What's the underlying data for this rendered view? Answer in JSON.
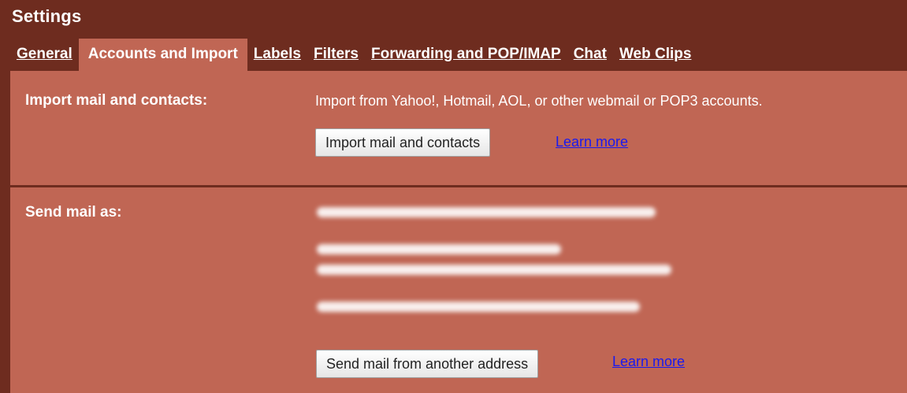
{
  "header": {
    "title": "Settings"
  },
  "tabs": [
    {
      "label": "General",
      "active": false
    },
    {
      "label": "Accounts and Import",
      "active": true
    },
    {
      "label": "Labels",
      "active": false
    },
    {
      "label": "Filters",
      "active": false
    },
    {
      "label": "Forwarding and POP/IMAP",
      "active": false
    },
    {
      "label": "Chat",
      "active": false
    },
    {
      "label": "Web Clips",
      "active": false
    }
  ],
  "import_section": {
    "label": "Import mail and contacts:",
    "description": "Import from Yahoo!, Hotmail, AOL, or other webmail or POP3 accounts.",
    "button_label": "Import mail and contacts",
    "learn_more": "Learn more"
  },
  "send_section": {
    "label": "Send mail as:",
    "button_label": "Send mail from another address",
    "learn_more": "Learn more"
  },
  "colors": {
    "header_bg": "#6e2c1f",
    "content_bg": "#c06654",
    "link": "#1a1aee",
    "text": "#ffffff"
  }
}
